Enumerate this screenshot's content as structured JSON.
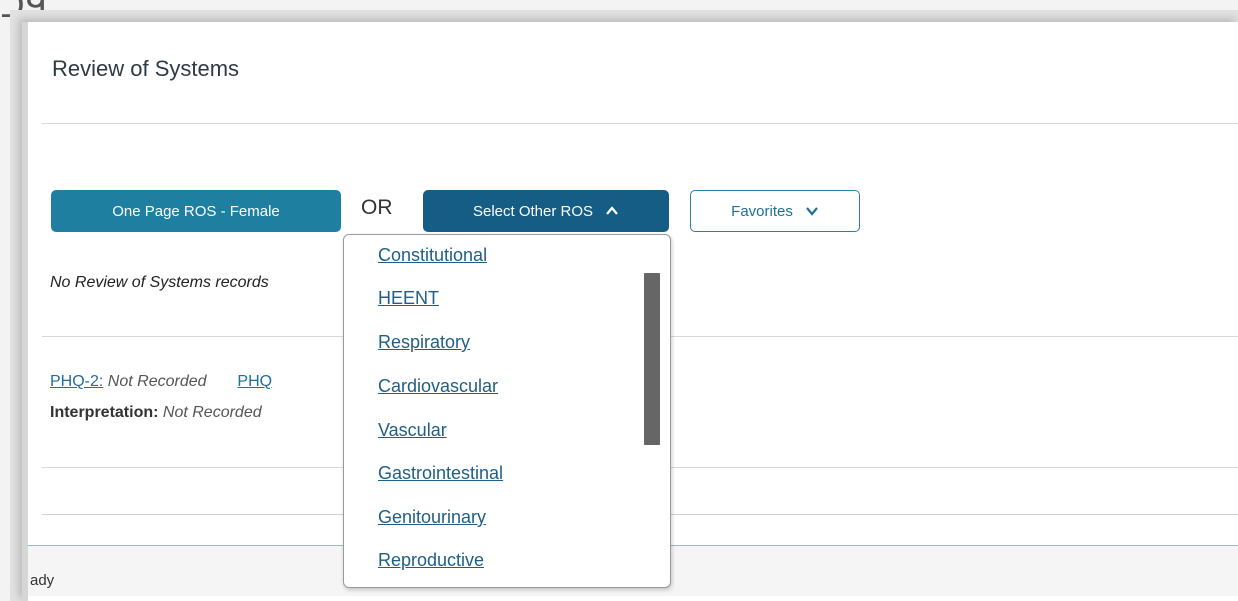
{
  "top_fragment": "ᑐᑫ.",
  "panel": {
    "title": "Review of Systems"
  },
  "actions": {
    "one_page_ros": "One Page ROS - Female",
    "or": "OR",
    "select_other": "Select Other ROS",
    "favorites": "Favorites"
  },
  "no_records_text": "No Review of Systems records",
  "phq": {
    "phq2_label": "PHQ-2:",
    "phq2_value": "Not Recorded",
    "phq9_label": "PHQ",
    "interpretation_label": "Interpretation:",
    "interpretation_value": "Not Recorded"
  },
  "status": {
    "text": "ady"
  },
  "dropdown": {
    "items": [
      "Constitutional",
      "HEENT",
      "Respiratory",
      "Cardiovascular",
      "Vascular",
      "Gastrointestinal",
      "Genitourinary",
      "Reproductive"
    ]
  },
  "colors": {
    "primary_button": "#1f7fa1",
    "select_button": "#165d86",
    "link": "#1f6f96"
  }
}
